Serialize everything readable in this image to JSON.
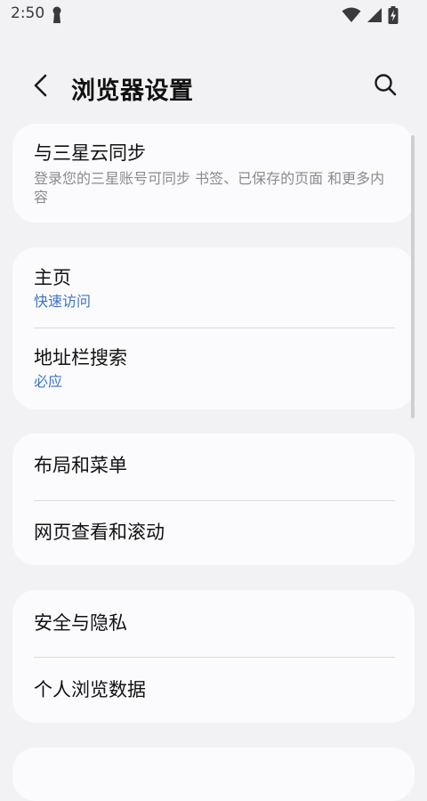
{
  "status_bar": {
    "time": "2:50"
  },
  "header": {
    "title": "浏览器设置",
    "back_icon": "chevron-left-icon",
    "search_icon": "search-icon"
  },
  "cards": [
    {
      "items": [
        {
          "title": "与三星云同步",
          "subtitle": "登录您的三星账号可同步 书签、已保存的页面 和更多内容"
        }
      ]
    },
    {
      "items": [
        {
          "title": "主页",
          "subtitle": "快速访问"
        },
        {
          "title": "地址栏搜索",
          "subtitle": "必应"
        }
      ]
    },
    {
      "items": [
        {
          "title": "布局和菜单"
        },
        {
          "title": "网页查看和滚动"
        }
      ]
    },
    {
      "items": [
        {
          "title": "安全与隐私"
        },
        {
          "title": "个人浏览数据"
        }
      ]
    }
  ],
  "colors": {
    "background": "#f2f2f4",
    "card": "#fbfbfd",
    "accent_blue": "#3e73c7",
    "subtitle_grey": "#8b8b8f"
  }
}
